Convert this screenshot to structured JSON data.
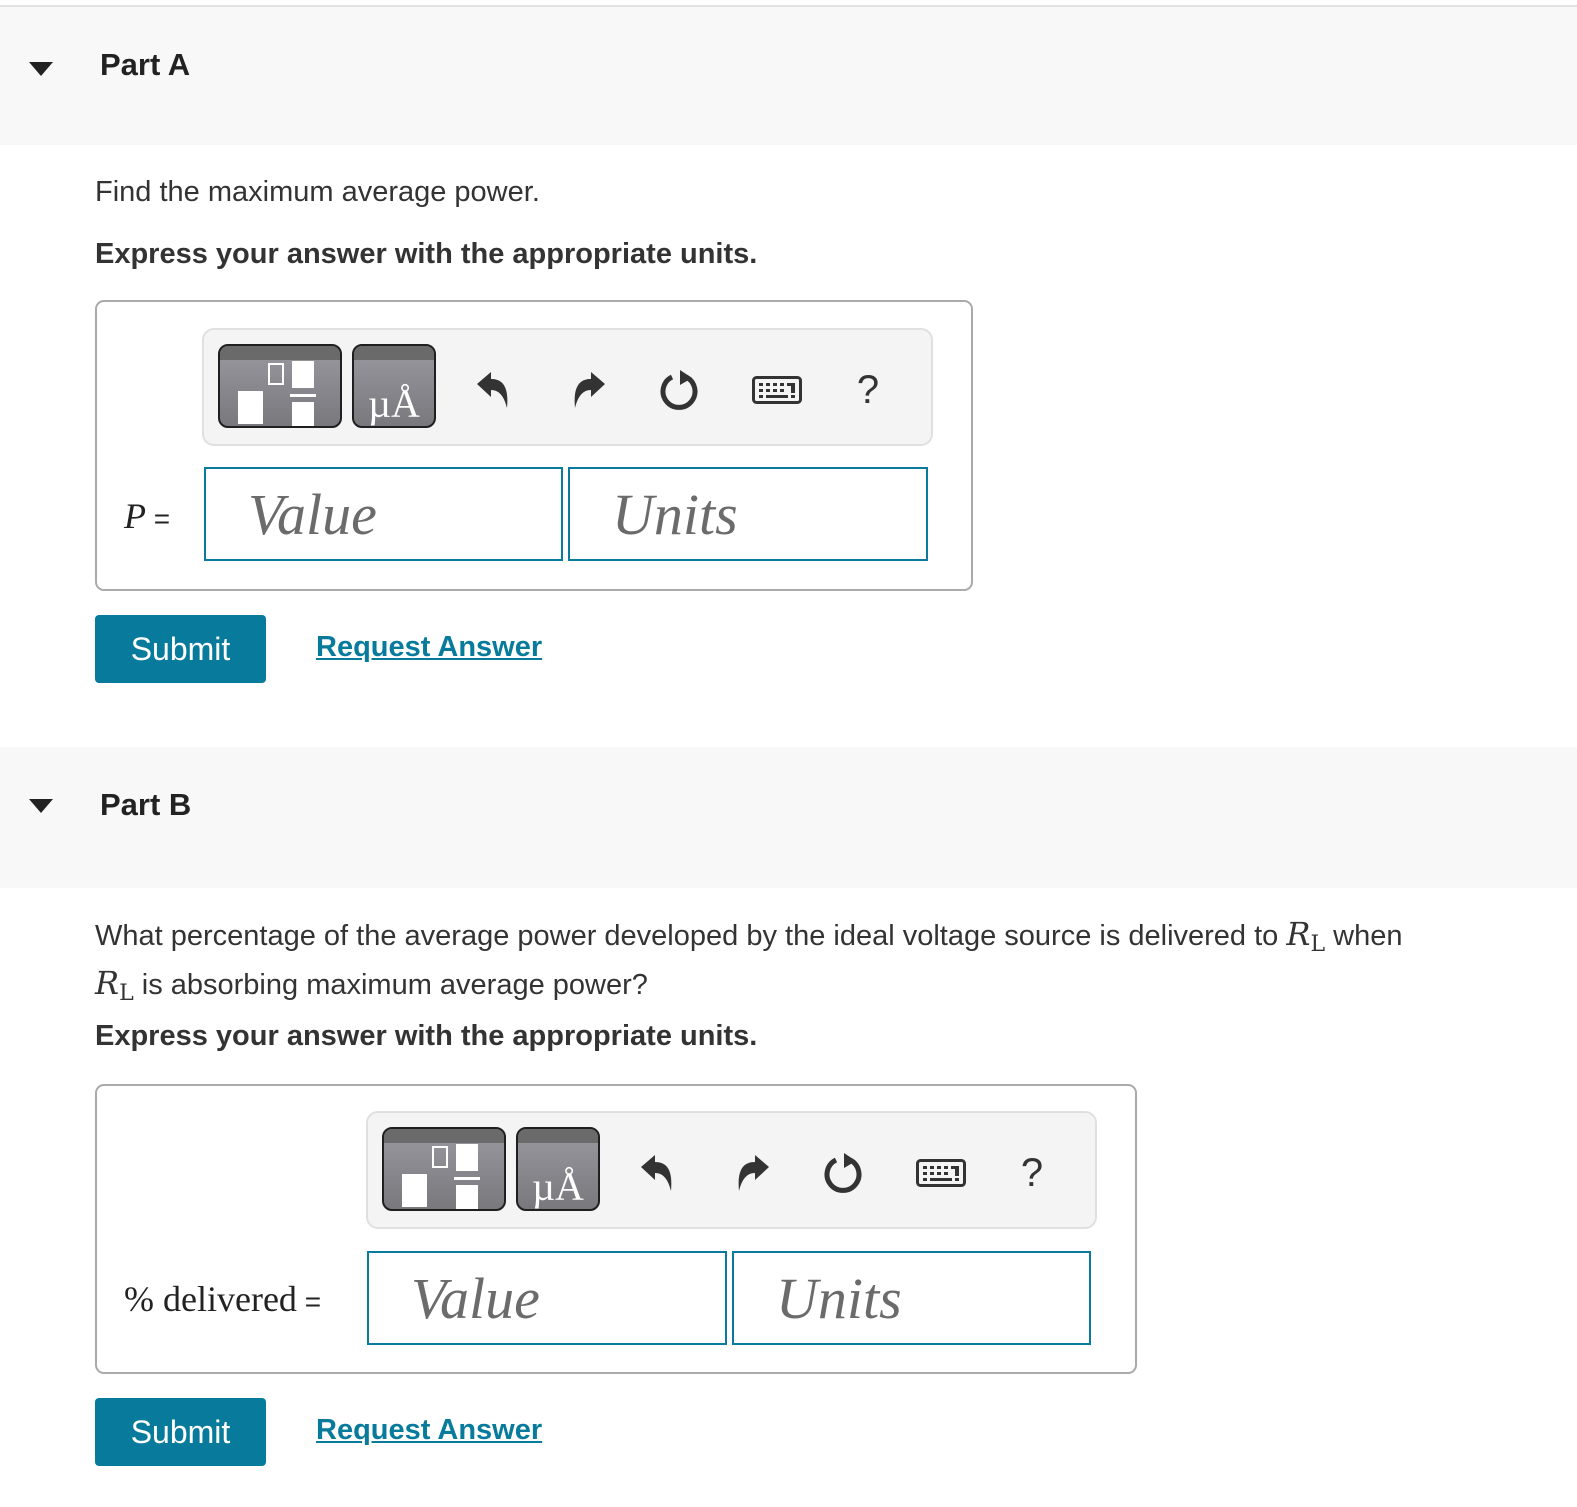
{
  "parts": [
    {
      "title": "Part A",
      "question": "Find the maximum average power.",
      "instruction": "Express your answer with the appropriate units.",
      "toolbar": {
        "template_button": "templates",
        "units_button": "µÅ",
        "undo": "undo",
        "redo": "redo",
        "reset": "reset",
        "keyboard": "keyboard",
        "help": "?"
      },
      "answer_label_var": "P",
      "answer_label_eq": " =",
      "value_placeholder": "Value",
      "units_placeholder": "Units",
      "value": "",
      "units": "",
      "submit_label": "Submit",
      "request_label": "Request Answer"
    },
    {
      "title": "Part B",
      "question_pre": "What percentage of the average power developed by the ideal voltage source is delivered to ",
      "question_mid": " when ",
      "question_post": " is absorbing maximum average power?",
      "math_var": "R",
      "math_sub": "L",
      "instruction": "Express your answer with the appropriate units.",
      "toolbar": {
        "template_button": "templates",
        "units_button": "µÅ",
        "undo": "undo",
        "redo": "redo",
        "reset": "reset",
        "keyboard": "keyboard",
        "help": "?"
      },
      "answer_label": "% delivered",
      "answer_label_eq": " =",
      "value_placeholder": "Value",
      "units_placeholder": "Units",
      "value": "",
      "units": "",
      "submit_label": "Submit",
      "request_label": "Request Answer"
    }
  ],
  "colors": {
    "accent": "#087b9d",
    "header_bg": "#f8f8f8",
    "toolbar_bg": "#f4f4f4"
  }
}
